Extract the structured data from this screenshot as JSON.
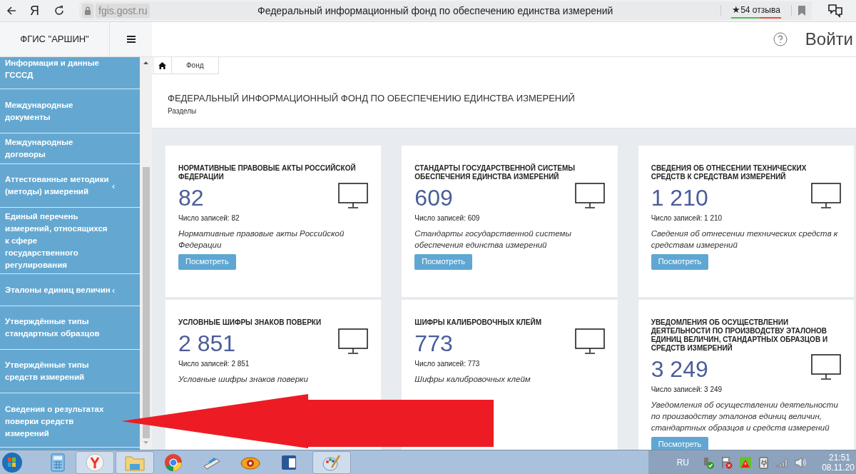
{
  "browser": {
    "logo": "Я",
    "url": "fgis.gost.ru",
    "title": "Федеральный информационный фонд по обеспечению единства измерений",
    "star": "★",
    "reviews": "54 отзыва"
  },
  "app_header": {
    "brand": "ФГИС \"АРШИН\"",
    "login": "Войти"
  },
  "sidebar": {
    "items": [
      {
        "label": "Информация и данные ГСССД"
      },
      {
        "label": "Международные документы"
      },
      {
        "label": "Международные договоры"
      },
      {
        "label": "Аттестованные методики (методы) измерений",
        "chevron": "‹"
      },
      {
        "label": "Единый перечень измерений, относящихся к сфере государственного регулирования"
      },
      {
        "label": "Эталоны единиц величин",
        "chevron": "‹"
      },
      {
        "label": "Утверждённые типы стандартных образцов"
      },
      {
        "label": "Утверждённые типы средств измерений"
      },
      {
        "label": "Сведения о результатах поверки средств измерений"
      }
    ]
  },
  "breadcrumb": [
    "Фонд"
  ],
  "page": {
    "title": "ФЕДЕРАЛЬНЫЙ ИНФОРМАЦИОННЫЙ ФОНД ПО ОБЕСПЕЧЕНИЮ ЕДИНСТВА ИЗМЕРЕНИЙ",
    "subtitle": "Разделы"
  },
  "cards": [
    {
      "title": "НОРМАТИВНЫЕ ПРАВОВЫЕ АКТЫ РОССИЙСКОЙ ФЕДЕРАЦИИ",
      "count": "82",
      "records": "Число записей: 82",
      "description": "Нормативные правовые акты Российской Федерации",
      "button": "Посмотреть"
    },
    {
      "title": "СТАНДАРТЫ ГОСУДАРСТВЕННОЙ СИСТЕМЫ ОБЕСПЕЧЕНИЯ ЕДИНСТВА ИЗМЕРЕНИЙ",
      "count": "609",
      "records": "Число записей: 609",
      "description": "Стандарты государственной системы обеспечения единства измерений",
      "button": "Посмотреть"
    },
    {
      "title": "СВЕДЕНИЯ ОБ ОТНЕСЕНИИ ТЕХНИЧЕСКИХ СРЕДСТВ К СРЕДСТВАМ ИЗМЕРЕНИЙ",
      "count": "1 210",
      "records": "Число записей: 1 210",
      "description": "Сведения об отнесении технических средств к средствам измерений",
      "button": "Посмотреть"
    },
    {
      "title": "УСЛОВНЫЕ ШИФРЫ ЗНАКОВ ПОВЕРКИ",
      "count": "2 851",
      "records": "Число записей: 2 851",
      "description": "Условные шифры знаков поверки"
    },
    {
      "title": "ШИФРЫ КАЛИБРОВОЧНЫХ КЛЕЙМ",
      "count": "773",
      "records": "Число записей: 773",
      "description": "Шифры калибровочных клейм"
    },
    {
      "title": "УВЕДОМЛЕНИЯ ОБ ОСУЩЕСТВЛЕНИИ ДЕЯТЕЛЬНОСТИ ПО ПРОИЗВОДСТВУ ЭТАЛОНОВ ЕДИНИЦ ВЕЛИЧИН, СТАНДАРТНЫХ ОБРАЗЦОВ И СРЕДСТВ ИЗМЕРЕНИЙ",
      "count": "3 249",
      "records": "Число записей: 3 249",
      "description": "Уведомления об осуществлении деятельности по производству эталонов единиц величин, стандартных образцов и средств измерений",
      "button": "Посмотреть"
    }
  ],
  "taskbar": {
    "language": "RU",
    "time": "21:51",
    "date": "08.11.20"
  }
}
